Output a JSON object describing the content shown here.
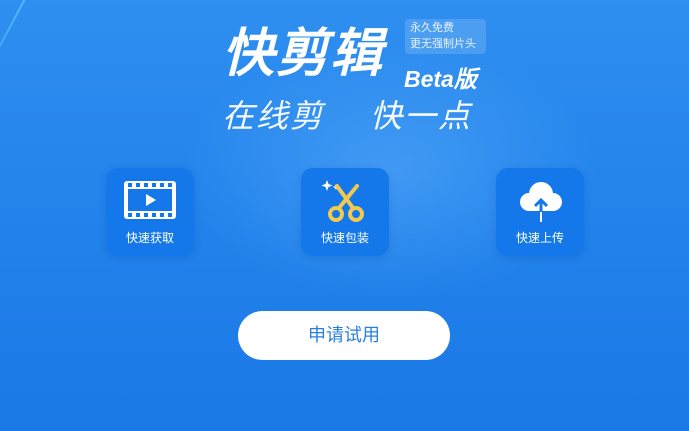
{
  "header": {
    "brand_name": "快剪辑",
    "beta": "Beta版",
    "badge_line1": "永久免费",
    "badge_line2": "更无强制片头",
    "slogan_left": "在线剪",
    "slogan_right": "快一点"
  },
  "features": [
    {
      "label": "快速获取",
      "icon": "video-play-icon"
    },
    {
      "label": "快速包装",
      "icon": "scissors-icon"
    },
    {
      "label": "快速上传",
      "icon": "cloud-upload-icon"
    }
  ],
  "cta": {
    "label": "申请试用"
  },
  "colors": {
    "background": "#2384ec",
    "tile": "#1478ea",
    "icon_gold": "#f2c94c",
    "button_text": "#2a7fe0"
  }
}
